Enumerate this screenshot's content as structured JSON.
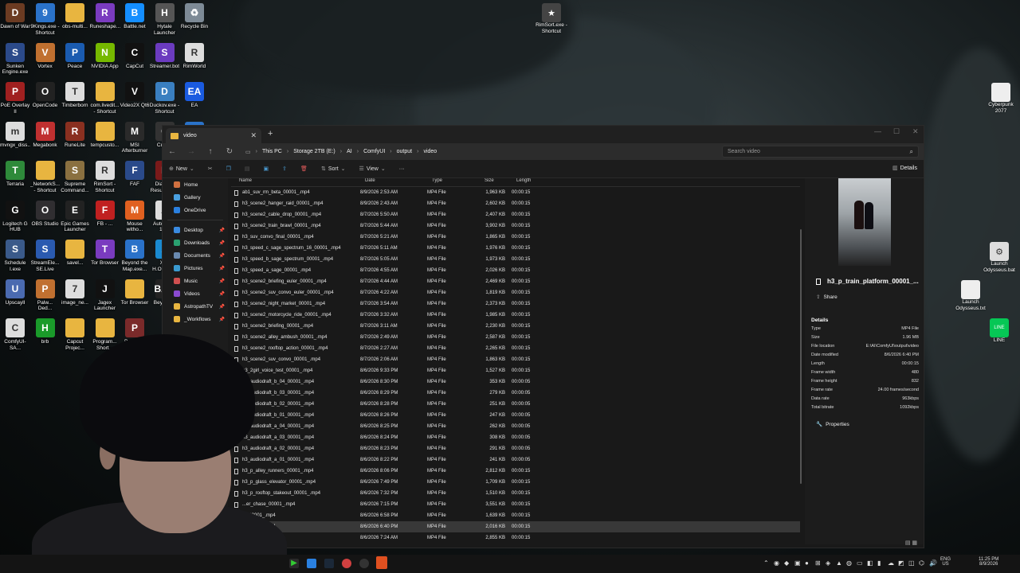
{
  "desktop_icons_left": [
    {
      "label": "Dawn of War",
      "color": "#6b3b22",
      "glyph": "D"
    },
    {
      "label": "9Kings.exe - Shortcut",
      "color": "#2a72c9",
      "glyph": "9"
    },
    {
      "label": "obs-multi...",
      "color": "#e8b540",
      "glyph": ""
    },
    {
      "label": "Runeshape...",
      "color": "#7a3bbf",
      "glyph": "R"
    },
    {
      "label": "Battle.net",
      "color": "#148eff",
      "glyph": "B"
    },
    {
      "label": "Hytale Launcher",
      "color": "#555",
      "glyph": "H"
    },
    {
      "label": "Recycle Bin",
      "color": "#7d8a96",
      "glyph": "♻"
    },
    {
      "label": "Sunken Engine.exe",
      "color": "#2b4a8a",
      "glyph": "S"
    },
    {
      "label": "Vortex",
      "color": "#c07030",
      "glyph": "V"
    },
    {
      "label": "Peace",
      "color": "#1a5bb0",
      "glyph": "P"
    },
    {
      "label": "NVIDIA App",
      "color": "#76b900",
      "glyph": "N"
    },
    {
      "label": "CapCut",
      "color": "#111",
      "glyph": "C"
    },
    {
      "label": "Streamer.bot",
      "color": "#6b3bbf",
      "glyph": "S"
    },
    {
      "label": "RimWorld",
      "color": "#ddd",
      "glyph": "R"
    },
    {
      "label": "PoE Overlay II",
      "color": "#a02020",
      "glyph": "P"
    },
    {
      "label": "OpenCode",
      "color": "#222",
      "glyph": "O"
    },
    {
      "label": "Timberborn",
      "color": "#ddd",
      "glyph": "T"
    },
    {
      "label": "com.livedit... - Shortcut",
      "color": "#e8b540",
      "glyph": ""
    },
    {
      "label": "Video2X Qt6",
      "color": "#111",
      "glyph": "V"
    },
    {
      "label": "Duckov.exe - Shortcut",
      "color": "#3a7fc0",
      "glyph": "D"
    },
    {
      "label": "EA",
      "color": "#1a5be0",
      "glyph": "EA"
    },
    {
      "label": "mvngx_diss...",
      "color": "#ddd",
      "glyph": "m"
    },
    {
      "label": "Megabonk",
      "color": "#c03030",
      "glyph": "M"
    },
    {
      "label": "RuneLite",
      "color": "#8a3020",
      "glyph": "R"
    },
    {
      "label": "tempcusto...",
      "color": "#e8b540",
      "glyph": ""
    },
    {
      "label": "MSI Afterburner",
      "color": "#2a2a2a",
      "glyph": "M"
    },
    {
      "label": "Curs...",
      "color": "#333",
      "glyph": "C"
    },
    {
      "label": "splittinglte...",
      "color": "#2a72c9",
      "glyph": "s"
    },
    {
      "label": "Terraria",
      "color": "#2e8a3a",
      "glyph": "T"
    },
    {
      "label": "_NetworkS... - Shortcut",
      "color": "#e8b540",
      "glyph": ""
    },
    {
      "label": "Supreme Command...",
      "color": "#8a7040",
      "glyph": "S"
    },
    {
      "label": "RimSort - Shortcut",
      "color": "#ddd",
      "glyph": "R"
    },
    {
      "label": "FAF",
      "color": "#2a4a8a",
      "glyph": "F"
    },
    {
      "label": "Diablo II Resurrected",
      "color": "#7a1a1a",
      "glyph": "D"
    },
    {
      "label": "PathOfExile... - Shortcut (2)",
      "color": "#5a3a2a",
      "glyph": "P"
    },
    {
      "label": "Logitech G HUB",
      "color": "#111",
      "glyph": "G"
    },
    {
      "label": "OBS Studio",
      "color": "#302e31",
      "glyph": "O"
    },
    {
      "label": "Epic Games Launcher",
      "color": "#222",
      "glyph": "E"
    },
    {
      "label": "FB - ...",
      "color": "#c02020",
      "glyph": "F"
    },
    {
      "label": "Mouse witho...",
      "color": "#e06020",
      "glyph": "M"
    },
    {
      "label": "Automatic 1111",
      "color": "#ddd",
      "glyph": "A"
    },
    {
      "label": "mouse.txt",
      "color": "#eee",
      "glyph": ""
    },
    {
      "label": "Schedule I.exe",
      "color": "#3a5a8a",
      "glyph": "S"
    },
    {
      "label": "StreamEle... SE.Live",
      "color": "#2a5ab0",
      "glyph": "S"
    },
    {
      "label": "savel...",
      "color": "#e8b540",
      "glyph": ""
    },
    {
      "label": "Tor Browser",
      "color": "#7a3bbf",
      "glyph": "T"
    },
    {
      "label": "Beyond the Map.exe...",
      "color": "#2a72c9",
      "glyph": "B"
    },
    {
      "label": "X52 H.O.T.A.S.",
      "color": "#1a8ad0",
      "glyph": "X"
    },
    {
      "label": "ComfyUI",
      "color": "#ddd",
      "glyph": "C"
    },
    {
      "label": "UpscaylI",
      "color": "#4a6ab0",
      "glyph": "U"
    },
    {
      "label": "Palw... Ded...",
      "color": "#c07030",
      "glyph": "P"
    },
    {
      "label": "image_ne...",
      "color": "#ddd",
      "glyph": "7"
    },
    {
      "label": "Jagex Launcher",
      "color": "#111",
      "glyph": "J"
    },
    {
      "label": "Tor Browser",
      "color": "#e8b540",
      "glyph": ""
    },
    {
      "label": "Beyond...",
      "color": "#222",
      "glyph": "BAR"
    },
    {
      "label": "Kingdom Come - Deli...",
      "color": "#eee",
      "glyph": "K"
    },
    {
      "label": "ComfyUI-SA...",
      "color": "#ddd",
      "glyph": "C"
    },
    {
      "label": "brb",
      "color": "#1a9a2a",
      "glyph": "H"
    },
    {
      "label": "Capcut Projec...",
      "color": "#e8b540",
      "glyph": ""
    },
    {
      "label": "Program... Short...",
      "color": "#e8b540",
      "glyph": ""
    },
    {
      "label": "PathOff - Sh...",
      "color": "#7a2a2a",
      "glyph": "P"
    }
  ],
  "desktop_icons_right": [
    {
      "label": "RimSort.exe - Shortcut",
      "color": "#444",
      "glyph": "★"
    },
    {
      "label": "Cyberpunk 2077",
      "color": "#eee",
      "glyph": ""
    },
    {
      "label": "Launch Odysseus.bat",
      "color": "#ddd",
      "glyph": "⚙"
    },
    {
      "label": "Launch Odysseus.txt",
      "color": "#eee",
      "glyph": ""
    },
    {
      "label": "LINE",
      "color": "#06c755",
      "glyph": "LINE"
    }
  ],
  "window": {
    "tab_title": "video",
    "close_tab": "✕",
    "new_tab": "+",
    "min": "—",
    "max": "☐",
    "close": "✕"
  },
  "breadcrumbs": [
    "This PC",
    "Storage 2TB (E:)",
    "AI",
    "ComfyUI",
    "output",
    "video"
  ],
  "search_placeholder": "Search video",
  "toolbar": {
    "new_label": "New",
    "sort_label": "Sort",
    "view_label": "View",
    "more_label": "···",
    "details_label": "Details"
  },
  "nav_pane": [
    {
      "label": "Home",
      "color": "#d07040",
      "pinned": false
    },
    {
      "label": "Gallery",
      "color": "#4aa0e0",
      "pinned": false
    },
    {
      "label": "OneDrive",
      "color": "#2a80e0",
      "pinned": false
    },
    {
      "label": "Desktop",
      "color": "#3a8ae0",
      "pinned": true
    },
    {
      "label": "Downloads",
      "color": "#2aa070",
      "pinned": true
    },
    {
      "label": "Documents",
      "color": "#6a8ab0",
      "pinned": true
    },
    {
      "label": "Pictures",
      "color": "#3a9ad0",
      "pinned": true
    },
    {
      "label": "Music",
      "color": "#d05050",
      "pinned": true
    },
    {
      "label": "Videos",
      "color": "#8a4ad0",
      "pinned": true
    },
    {
      "label": "AstropathTV",
      "color": "#e8b540",
      "pinned": true
    },
    {
      "label": "_Workflows",
      "color": "#e8b540",
      "pinned": true
    }
  ],
  "columns": {
    "name": "Name",
    "date": "Date",
    "type": "Type",
    "size": "Size",
    "length": "Length"
  },
  "files": [
    {
      "name": "ab1_suv_rm_beta_00001_.mp4",
      "date": "8/9/2026 2:53 AM",
      "type": "MP4 File",
      "size": "1,963 KB",
      "length": "00:00:15"
    },
    {
      "name": "h3_scene2_hanger_raid_00001_.mp4",
      "date": "8/9/2026 2:43 AM",
      "type": "MP4 File",
      "size": "2,602 KB",
      "length": "00:00:15"
    },
    {
      "name": "h3_scene2_cable_drop_00001_.mp4",
      "date": "8/7/2026 5:50 AM",
      "type": "MP4 File",
      "size": "2,407 KB",
      "length": "00:00:15"
    },
    {
      "name": "h3_scene2_train_brawl_00001_.mp4",
      "date": "8/7/2026 5:44 AM",
      "type": "MP4 File",
      "size": "3,902 KB",
      "length": "00:00:15"
    },
    {
      "name": "h3_suv_convo_final_00001_.mp4",
      "date": "8/7/2026 5:21 AM",
      "type": "MP4 File",
      "size": "1,865 KB",
      "length": "00:00:15"
    },
    {
      "name": "h3_speed_c_sage_spectrum_16_00001_.mp4",
      "date": "8/7/2026 5:11 AM",
      "type": "MP4 File",
      "size": "1,976 KB",
      "length": "00:00:15"
    },
    {
      "name": "h3_speed_b_sage_spectrum_00001_.mp4",
      "date": "8/7/2026 5:05 AM",
      "type": "MP4 File",
      "size": "1,973 KB",
      "length": "00:00:15"
    },
    {
      "name": "h3_speed_a_sage_00001_.mp4",
      "date": "8/7/2026 4:55 AM",
      "type": "MP4 File",
      "size": "2,026 KB",
      "length": "00:00:15"
    },
    {
      "name": "h3_scene2_briefing_euler_00001_.mp4",
      "date": "8/7/2026 4:44 AM",
      "type": "MP4 File",
      "size": "2,469 KB",
      "length": "00:00:15"
    },
    {
      "name": "h3_scene2_suv_convo_euler_00001_.mp4",
      "date": "8/7/2026 4:22 AM",
      "type": "MP4 File",
      "size": "1,819 KB",
      "length": "00:00:15"
    },
    {
      "name": "h3_scene2_night_market_00001_.mp4",
      "date": "8/7/2026 3:54 AM",
      "type": "MP4 File",
      "size": "2,373 KB",
      "length": "00:00:15"
    },
    {
      "name": "h3_scene2_motorcycle_ride_00001_.mp4",
      "date": "8/7/2026 3:32 AM",
      "type": "MP4 File",
      "size": "1,985 KB",
      "length": "00:00:15"
    },
    {
      "name": "h3_scene2_briefing_00001_.mp4",
      "date": "8/7/2026 3:11 AM",
      "type": "MP4 File",
      "size": "2,230 KB",
      "length": "00:00:15"
    },
    {
      "name": "h3_scene2_alley_ambush_00001_.mp4",
      "date": "8/7/2026 2:49 AM",
      "type": "MP4 File",
      "size": "2,587 KB",
      "length": "00:00:15"
    },
    {
      "name": "h3_scene2_rooftop_action_00001_.mp4",
      "date": "8/7/2026 2:27 AM",
      "type": "MP4 File",
      "size": "2,265 KB",
      "length": "00:00:15"
    },
    {
      "name": "h3_scene2_suv_convo_00001_.mp4",
      "date": "8/7/2026 2:06 AM",
      "type": "MP4 File",
      "size": "1,863 KB",
      "length": "00:00:15"
    },
    {
      "name": "h3_2girl_voice_test_00001_.mp4",
      "date": "8/6/2026 9:33 PM",
      "type": "MP4 File",
      "size": "1,527 KB",
      "length": "00:00:15"
    },
    {
      "name": "h3_audiodraft_b_04_00001_.mp4",
      "date": "8/6/2026 8:30 PM",
      "type": "MP4 File",
      "size": "353 KB",
      "length": "00:00:05"
    },
    {
      "name": "h3_audiodraft_b_03_00001_.mp4",
      "date": "8/6/2026 8:29 PM",
      "type": "MP4 File",
      "size": "279 KB",
      "length": "00:00:05"
    },
    {
      "name": "h3_audiodraft_b_02_00001_.mp4",
      "date": "8/6/2026 8:28 PM",
      "type": "MP4 File",
      "size": "251 KB",
      "length": "00:00:05"
    },
    {
      "name": "h3_audiodraft_b_01_00001_.mp4",
      "date": "8/6/2026 8:26 PM",
      "type": "MP4 File",
      "size": "247 KB",
      "length": "00:00:05"
    },
    {
      "name": "h3_audiodraft_a_04_00001_.mp4",
      "date": "8/6/2026 8:25 PM",
      "type": "MP4 File",
      "size": "262 KB",
      "length": "00:00:05"
    },
    {
      "name": "h3_audiodraft_a_03_00001_.mp4",
      "date": "8/6/2026 8:24 PM",
      "type": "MP4 File",
      "size": "308 KB",
      "length": "00:00:05"
    },
    {
      "name": "h3_audiodraft_a_02_00001_.mp4",
      "date": "8/6/2026 8:23 PM",
      "type": "MP4 File",
      "size": "291 KB",
      "length": "00:00:05"
    },
    {
      "name": "h3_audiodraft_a_01_00001_.mp4",
      "date": "8/6/2026 8:22 PM",
      "type": "MP4 File",
      "size": "241 KB",
      "length": "00:00:05"
    },
    {
      "name": "h3_p_alley_runners_00001_.mp4",
      "date": "8/6/2026 8:06 PM",
      "type": "MP4 File",
      "size": "2,812 KB",
      "length": "00:00:15"
    },
    {
      "name": "h3_p_glass_elevator_00001_.mp4",
      "date": "8/6/2026 7:49 PM",
      "type": "MP4 File",
      "size": "1,709 KB",
      "length": "00:00:15"
    },
    {
      "name": "h3_p_rooftop_stakeout_00001_.mp4",
      "date": "8/6/2026 7:32 PM",
      "type": "MP4 File",
      "size": "1,510 KB",
      "length": "00:00:15"
    },
    {
      "name": "...er_chase_00001_.mp4",
      "date": "8/6/2026 7:15 PM",
      "type": "MP4 File",
      "size": "3,551 KB",
      "length": "00:00:15"
    },
    {
      "name": "..._00001_.mp4",
      "date": "8/6/2026 6:58 PM",
      "type": "MP4 File",
      "size": "1,639 KB",
      "length": "00:00:15"
    },
    {
      "name": "..._00001_.mp4",
      "date": "8/6/2026 6:40 PM",
      "type": "MP4 File",
      "size": "2,016 KB",
      "length": "00:00:15",
      "selected": true
    },
    {
      "name": "...et_00001_.mp4",
      "date": "8/6/2026 7:24 AM",
      "type": "MP4 File",
      "size": "2,855 KB",
      "length": "00:00:15"
    }
  ],
  "details_pane": {
    "file_name": "h3_p_train_platform_00001_...",
    "share_label": "Share",
    "section_title": "Details",
    "properties": [
      {
        "k": "Type",
        "v": "MP4 File"
      },
      {
        "k": "Size",
        "v": "1.96 MB"
      },
      {
        "k": "File location",
        "v": "E:\\AI\\ComfyUI\\output\\video"
      },
      {
        "k": "Date modified",
        "v": "8/6/2026 6:40 PM"
      },
      {
        "k": "Length",
        "v": "00:00:15"
      },
      {
        "k": "Frame width",
        "v": "480"
      },
      {
        "k": "Frame height",
        "v": "832"
      },
      {
        "k": "Frame rate",
        "v": "24.00 frames/second"
      },
      {
        "k": "Data rate",
        "v": "963kbps"
      },
      {
        "k": "Total bitrate",
        "v": "1092kbps"
      }
    ],
    "properties_button": "Properties"
  },
  "tray": {
    "lang": "ENG",
    "region": "US",
    "time": "11:25 PM",
    "date": "8/9/2026"
  }
}
